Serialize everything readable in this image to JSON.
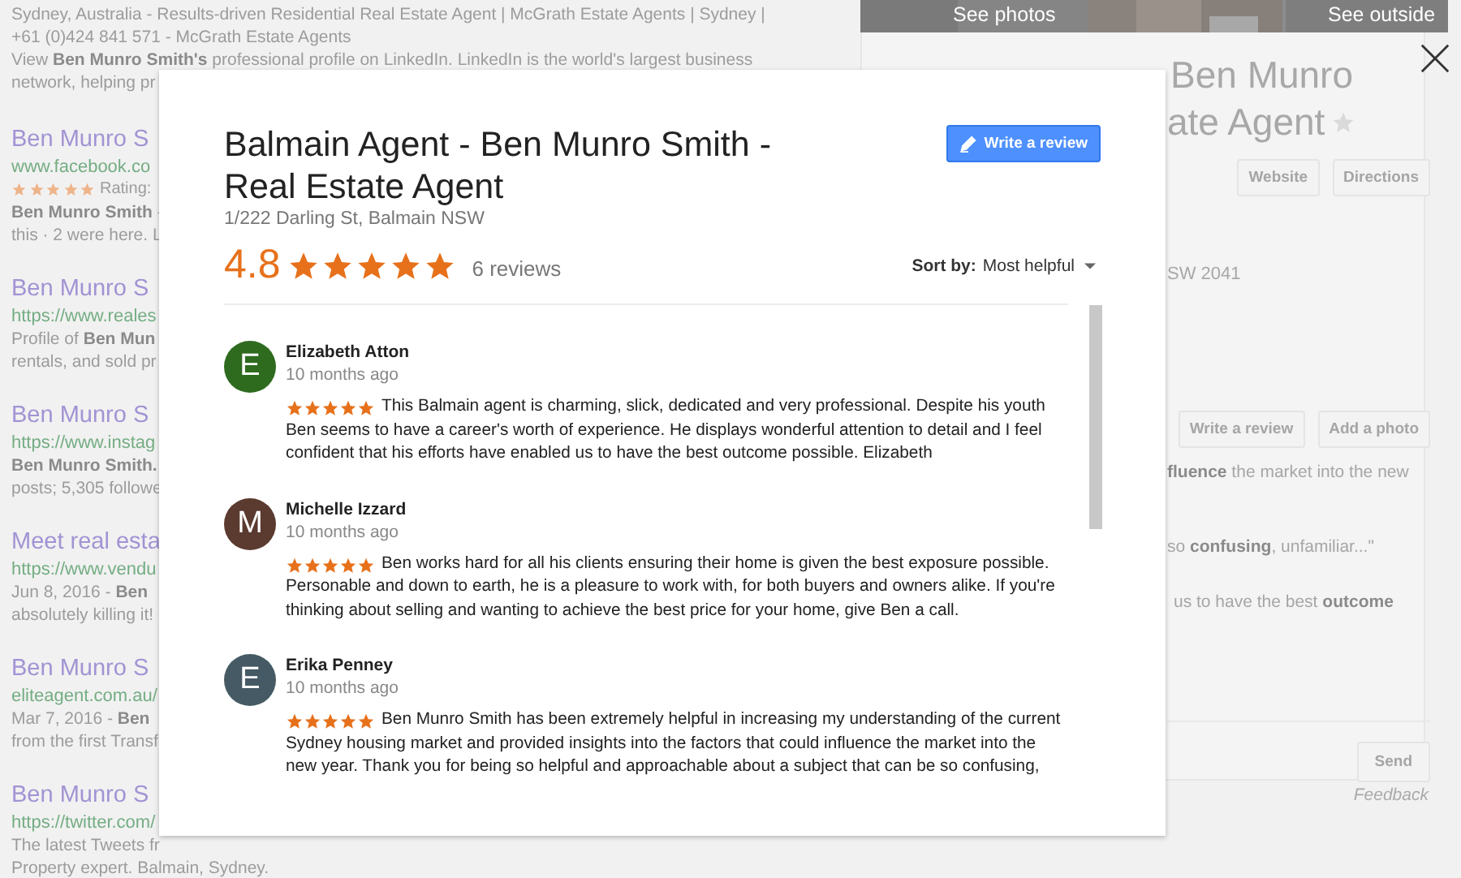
{
  "results": [
    {
      "lines": [
        "Sydney, Australia - Results-driven Residential Real Estate Agent | McGrath Estate Agents | Sydney |",
        "+61 (0)424 841 571 - McGrath Estate Agents",
        "View **Ben Munro Smith's** professional profile on LinkedIn. LinkedIn is the world's largest business",
        "network, helping pr"
      ]
    },
    {
      "title": "Ben Munro S",
      "url": "www.facebook.co",
      "rating": {
        "stars": 5,
        "label": "Rating:"
      },
      "lines": [
        "**Ben Munro Smith** -",
        "this · 2 were here. L"
      ]
    },
    {
      "title": "Ben Munro S",
      "url": "https://www.reales",
      "lines": [
        "Profile of **Ben Mun**",
        "rentals, and sold pr"
      ]
    },
    {
      "title": "Ben Munro S",
      "url": "https://www.instag",
      "lines": [
        "**Ben Munro Smith.**",
        "posts; 5,305 followe"
      ]
    },
    {
      "title": "Meet real esta",
      "url": "https://www.vendu",
      "lines": [
        "Jun 8, 2016 - **Ben**",
        "absolutely killing it!"
      ]
    },
    {
      "title": "Ben Munro S",
      "url": "eliteagent.com.au/",
      "lines": [
        "Mar 7, 2016 - **Ben**",
        "from the first Transf"
      ]
    },
    {
      "title": "Ben Munro S",
      "url": "https://twitter.com/",
      "lines": [
        "The latest Tweets fr",
        "Property expert. Balmain, Sydney."
      ]
    }
  ],
  "knowledge_panel": {
    "photo_labels": [
      "See photos",
      "See outside"
    ],
    "title_lines": [
      "Ben Munro",
      "ate Agent"
    ],
    "buttons": [
      "Website",
      "Directions"
    ],
    "address": "SW 2041",
    "review_buttons": [
      "Write a review",
      "Add a photo"
    ],
    "snippets": [
      "**fluence** the market into the new",
      "so **confusing**, unfamiliar...\"",
      "us to have the best **outcome**"
    ],
    "send": "Send",
    "feedback": "Feedback"
  },
  "dialog": {
    "title": "Balmain Agent - Ben Munro Smith - Real Estate Agent",
    "address": "1/222 Darling St, Balmain NSW",
    "rating": "4.8",
    "stars": 5,
    "review_count": "6 reviews",
    "write_review": "Write a review",
    "sort_label": "Sort by:",
    "sort_value": "Most helpful",
    "reviews": [
      {
        "initial": "E",
        "color": "#2e6b1f",
        "name": "Elizabeth Atton",
        "time": "10 months ago",
        "stars": 5,
        "text": "This Balmain agent is charming, slick, dedicated and very professional.  Despite his youth Ben seems to have a career's worth of experience.  He displays wonderful attention to detail and I feel confident that his efforts have enabled us to have the best outcome possible.  Elizabeth"
      },
      {
        "initial": "M",
        "color": "#5b3a2f",
        "name": "Michelle Izzard",
        "time": "10 months ago",
        "stars": 5,
        "text": "Ben works hard for all his clients ensuring their home is given the best exposure possible. Personable and down to earth, he is a pleasure to work with, for both buyers and owners alike. If you're thinking about selling and wanting to achieve the best price for your home, give Ben a call."
      },
      {
        "initial": "E",
        "color": "#455a64",
        "name": "Erika Penney",
        "time": "10 months ago",
        "stars": 5,
        "text": "Ben Munro Smith has been extremely helpful in increasing my understanding of the current Sydney housing market and provided insights into the factors that could influence the market into the new year. Thank you for being so helpful and approachable about a subject that can be so confusing,"
      }
    ]
  }
}
